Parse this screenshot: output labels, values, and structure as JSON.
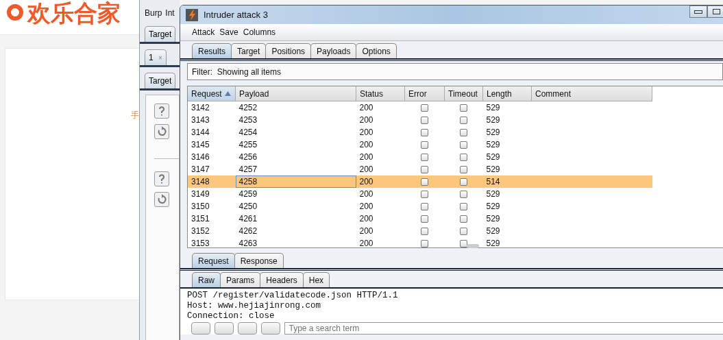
{
  "background_page": {
    "logo": "欢乐合家",
    "side_text": "手"
  },
  "burp_window": {
    "menu": [
      "Burp",
      "Int"
    ],
    "tabs": [
      {
        "label": "Target",
        "selected": true
      }
    ],
    "sub_tabs": [
      {
        "label": "1",
        "close": "×",
        "selected": true
      }
    ],
    "inner_tabs": [
      {
        "label": "Target",
        "selected": true
      }
    ]
  },
  "window": {
    "title": "Intruder attack 3"
  },
  "menu": [
    "Attack",
    "Save",
    "Columns"
  ],
  "tabs": [
    {
      "label": "Results",
      "selected": true
    },
    {
      "label": "Target",
      "selected": false
    },
    {
      "label": "Positions",
      "selected": false
    },
    {
      "label": "Payloads",
      "selected": false
    },
    {
      "label": "Options",
      "selected": false
    }
  ],
  "filter": "Filter:  Showing all items",
  "table": {
    "columns": [
      {
        "label": "Request",
        "sorted": true
      },
      {
        "label": "Payload",
        "sorted": false
      },
      {
        "label": "Status",
        "sorted": false
      },
      {
        "label": "Error",
        "sorted": false
      },
      {
        "label": "Timeout",
        "sorted": false
      },
      {
        "label": "Length",
        "sorted": false
      },
      {
        "label": "Comment",
        "sorted": false
      }
    ],
    "rows": [
      {
        "request": "3142",
        "payload": "4252",
        "status": "200",
        "error": false,
        "timeout": false,
        "length": "529",
        "selected": false
      },
      {
        "request": "3143",
        "payload": "4253",
        "status": "200",
        "error": false,
        "timeout": false,
        "length": "529",
        "selected": false
      },
      {
        "request": "3144",
        "payload": "4254",
        "status": "200",
        "error": false,
        "timeout": false,
        "length": "529",
        "selected": false
      },
      {
        "request": "3145",
        "payload": "4255",
        "status": "200",
        "error": false,
        "timeout": false,
        "length": "529",
        "selected": false
      },
      {
        "request": "3146",
        "payload": "4256",
        "status": "200",
        "error": false,
        "timeout": false,
        "length": "529",
        "selected": false
      },
      {
        "request": "3147",
        "payload": "4257",
        "status": "200",
        "error": false,
        "timeout": false,
        "length": "529",
        "selected": false
      },
      {
        "request": "3148",
        "payload": "4258",
        "status": "200",
        "error": false,
        "timeout": false,
        "length": "514",
        "selected": true
      },
      {
        "request": "3149",
        "payload": "4259",
        "status": "200",
        "error": false,
        "timeout": false,
        "length": "529",
        "selected": false
      },
      {
        "request": "3150",
        "payload": "4250",
        "status": "200",
        "error": false,
        "timeout": false,
        "length": "529",
        "selected": false
      },
      {
        "request": "3151",
        "payload": "4261",
        "status": "200",
        "error": false,
        "timeout": false,
        "length": "529",
        "selected": false
      },
      {
        "request": "3152",
        "payload": "4262",
        "status": "200",
        "error": false,
        "timeout": false,
        "length": "529",
        "selected": false
      },
      {
        "request": "3153",
        "payload": "4263",
        "status": "200",
        "error": false,
        "timeout": false,
        "length": "529",
        "selected": false
      }
    ]
  },
  "message_tabs": [
    {
      "label": "Request",
      "selected": true
    },
    {
      "label": "Response",
      "selected": false
    }
  ],
  "view_tabs": [
    {
      "label": "Raw",
      "selected": true
    },
    {
      "label": "Params",
      "selected": false
    },
    {
      "label": "Headers",
      "selected": false
    },
    {
      "label": "Hex",
      "selected": false
    }
  ],
  "raw_lines": [
    "POST /register/validatecode.json HTTP/1.1",
    "Host: www.hejiajinrong.com",
    "Connection: close"
  ],
  "search": {
    "placeholder": "Type a search term"
  }
}
